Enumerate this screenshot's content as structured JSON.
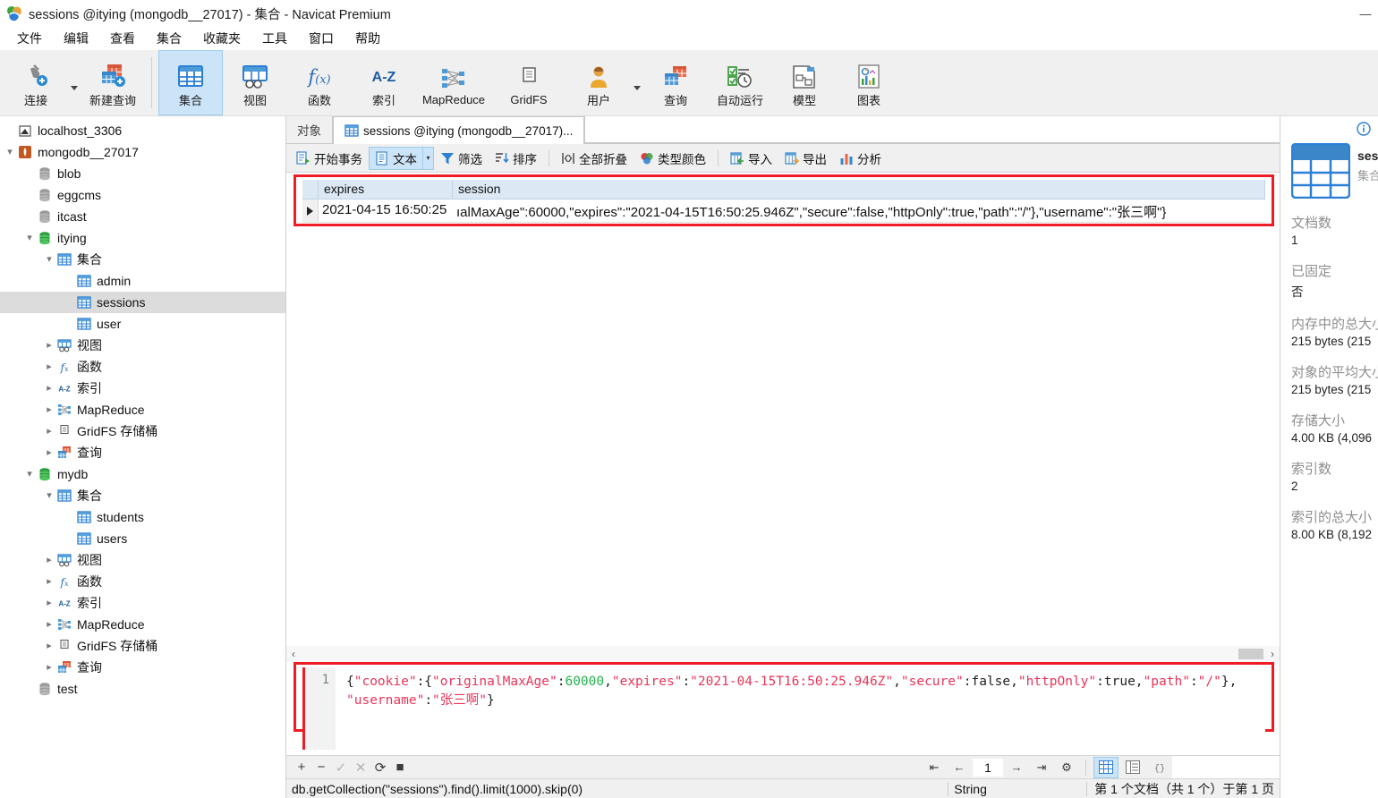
{
  "window": {
    "title": "sessions @itying (mongodb__27017) - 集合 - Navicat Premium",
    "minimize_label": "—",
    "logo_icon": "navicat-logo-icon"
  },
  "menubar": {
    "items": [
      {
        "label": "文件",
        "name": "menu-file"
      },
      {
        "label": "编辑",
        "name": "menu-edit"
      },
      {
        "label": "查看",
        "name": "menu-view"
      },
      {
        "label": "集合",
        "name": "menu-collection"
      },
      {
        "label": "收藏夹",
        "name": "menu-favorites"
      },
      {
        "label": "工具",
        "name": "menu-tools"
      },
      {
        "label": "窗口",
        "name": "menu-window"
      },
      {
        "label": "帮助",
        "name": "menu-help"
      }
    ]
  },
  "toolbar": {
    "items": [
      {
        "label": "连接",
        "icon": "connection-icon",
        "active": false,
        "caret": true
      },
      {
        "label": "新建查询",
        "icon": "new-query-icon",
        "active": false,
        "caret": false
      },
      {
        "label": "集合",
        "icon": "collection-icon",
        "active": true,
        "caret": false
      },
      {
        "label": "视图",
        "icon": "view-icon",
        "active": false,
        "caret": false
      },
      {
        "label": "函数",
        "icon": "function-icon",
        "active": false,
        "caret": false
      },
      {
        "label": "索引",
        "icon": "index-icon",
        "active": false,
        "caret": false
      },
      {
        "label": "MapReduce",
        "icon": "mapreduce-icon",
        "active": false,
        "caret": false
      },
      {
        "label": "GridFS",
        "icon": "gridfs-icon",
        "active": false,
        "caret": false
      },
      {
        "label": "用户",
        "icon": "user-icon",
        "active": false,
        "caret": true
      },
      {
        "label": "查询",
        "icon": "query-icon",
        "active": false,
        "caret": false
      },
      {
        "label": "自动运行",
        "icon": "automation-icon",
        "active": false,
        "caret": false
      },
      {
        "label": "模型",
        "icon": "model-icon",
        "active": false,
        "caret": false
      },
      {
        "label": "图表",
        "icon": "chart-icon",
        "active": false,
        "caret": false
      }
    ]
  },
  "sidebar": {
    "items": [
      {
        "label": "localhost_3306",
        "icon": "mysql-connection-icon",
        "indent": 0,
        "twisty": "",
        "selected": false
      },
      {
        "label": "mongodb__27017",
        "icon": "mongodb-connection-icon",
        "indent": 0,
        "twisty": "down",
        "selected": false
      },
      {
        "label": "blob",
        "icon": "database-icon",
        "indent": 1,
        "twisty": "",
        "selected": false
      },
      {
        "label": "eggcms",
        "icon": "database-icon",
        "indent": 1,
        "twisty": "",
        "selected": false
      },
      {
        "label": "itcast",
        "icon": "database-icon",
        "indent": 1,
        "twisty": "",
        "selected": false
      },
      {
        "label": "itying",
        "icon": "database-active-icon",
        "indent": 1,
        "twisty": "down",
        "selected": false
      },
      {
        "label": "集合",
        "icon": "collections-folder-icon",
        "indent": 2,
        "twisty": "down",
        "selected": false
      },
      {
        "label": "admin",
        "icon": "collection-item-icon",
        "indent": 3,
        "twisty": "",
        "selected": false
      },
      {
        "label": "sessions",
        "icon": "collection-item-icon",
        "indent": 3,
        "twisty": "",
        "selected": true
      },
      {
        "label": "user",
        "icon": "collection-item-icon",
        "indent": 3,
        "twisty": "",
        "selected": false
      },
      {
        "label": "视图",
        "icon": "views-folder-icon",
        "indent": 2,
        "twisty": "right",
        "selected": false
      },
      {
        "label": "函数",
        "icon": "functions-folder-icon",
        "indent": 2,
        "twisty": "right",
        "selected": false
      },
      {
        "label": "索引",
        "icon": "indexes-folder-icon",
        "indent": 2,
        "twisty": "right",
        "selected": false
      },
      {
        "label": "MapReduce",
        "icon": "mapreduce-folder-icon",
        "indent": 2,
        "twisty": "right",
        "selected": false
      },
      {
        "label": "GridFS 存储桶",
        "icon": "gridfs-folder-icon",
        "indent": 2,
        "twisty": "right",
        "selected": false
      },
      {
        "label": "查询",
        "icon": "queries-folder-icon",
        "indent": 2,
        "twisty": "right",
        "selected": false
      },
      {
        "label": "mydb",
        "icon": "database-active-icon",
        "indent": 1,
        "twisty": "down",
        "selected": false
      },
      {
        "label": "集合",
        "icon": "collections-folder-icon",
        "indent": 2,
        "twisty": "down",
        "selected": false
      },
      {
        "label": "students",
        "icon": "collection-item-icon",
        "indent": 3,
        "twisty": "",
        "selected": false
      },
      {
        "label": "users",
        "icon": "collection-item-icon",
        "indent": 3,
        "twisty": "",
        "selected": false
      },
      {
        "label": "视图",
        "icon": "views-folder-icon",
        "indent": 2,
        "twisty": "right",
        "selected": false
      },
      {
        "label": "函数",
        "icon": "functions-folder-icon",
        "indent": 2,
        "twisty": "right",
        "selected": false
      },
      {
        "label": "索引",
        "icon": "indexes-folder-icon",
        "indent": 2,
        "twisty": "right",
        "selected": false
      },
      {
        "label": "MapReduce",
        "icon": "mapreduce-folder-icon",
        "indent": 2,
        "twisty": "right",
        "selected": false
      },
      {
        "label": "GridFS 存储桶",
        "icon": "gridfs-folder-icon",
        "indent": 2,
        "twisty": "right",
        "selected": false
      },
      {
        "label": "查询",
        "icon": "queries-folder-icon",
        "indent": 2,
        "twisty": "right",
        "selected": false
      },
      {
        "label": "test",
        "icon": "database-icon",
        "indent": 1,
        "twisty": "",
        "selected": false
      }
    ]
  },
  "tabs": [
    {
      "label": "对象",
      "icon": "",
      "active": false
    },
    {
      "label": "sessions @itying (mongodb__27017)...",
      "icon": "collection-item-icon",
      "active": true
    }
  ],
  "subtoolbar": {
    "items": [
      {
        "label": "开始事务",
        "icon": "begin-transaction-icon",
        "toggled": false,
        "split": false
      },
      {
        "label": "文本",
        "icon": "text-view-icon",
        "toggled": true,
        "split": true
      },
      {
        "label": "筛选",
        "icon": "filter-icon",
        "toggled": false,
        "split": false
      },
      {
        "label": "排序",
        "icon": "sort-icon",
        "toggled": false,
        "split": false
      },
      {
        "label": "全部折叠",
        "icon": "collapse-all-icon",
        "toggled": false,
        "split": false
      },
      {
        "label": "类型颜色",
        "icon": "type-color-icon",
        "toggled": false,
        "split": false
      },
      {
        "label": "导入",
        "icon": "import-icon",
        "toggled": false,
        "split": false
      },
      {
        "label": "导出",
        "icon": "export-icon",
        "toggled": false,
        "split": false
      },
      {
        "label": "分析",
        "icon": "analyze-icon",
        "toggled": false,
        "split": false
      }
    ]
  },
  "grid": {
    "columns": [
      "expires",
      "session"
    ],
    "rows": [
      {
        "expires": "2021-04-15 16:50:25",
        "session": "ıalMaxAge\":60000,\"expires\":\"2021-04-15T16:50:25.946Z\",\"secure\":false,\"httpOnly\":true,\"path\":\"/\"},\"username\":\"张三啊\"}"
      }
    ]
  },
  "editor": {
    "line_number": "1",
    "tokens": [
      {
        "t": "{",
        "k": "punc"
      },
      {
        "t": "\"cookie\"",
        "k": "str"
      },
      {
        "t": ":{",
        "k": "punc"
      },
      {
        "t": "\"originalMaxAge\"",
        "k": "str"
      },
      {
        "t": ":",
        "k": "punc"
      },
      {
        "t": "60000",
        "k": "num"
      },
      {
        "t": ",",
        "k": "punc"
      },
      {
        "t": "\"expires\"",
        "k": "str"
      },
      {
        "t": ":",
        "k": "punc"
      },
      {
        "t": "\"2021-04-15T16:50:25.946Z\"",
        "k": "str"
      },
      {
        "t": ",",
        "k": "punc"
      },
      {
        "t": "\"secure\"",
        "k": "str"
      },
      {
        "t": ":false,",
        "k": "punc"
      },
      {
        "t": "\"httpOnly\"",
        "k": "str"
      },
      {
        "t": ":true,",
        "k": "punc"
      },
      {
        "t": "\"path\"",
        "k": "str"
      },
      {
        "t": ":",
        "k": "punc"
      },
      {
        "t": "\"/\"",
        "k": "str"
      },
      {
        "t": "},",
        "k": "punc"
      },
      {
        "t": "\n",
        "k": "punc"
      },
      {
        "t": "\"username\"",
        "k": "str"
      },
      {
        "t": ":",
        "k": "punc"
      },
      {
        "t": "\"张三啊\"",
        "k": "str"
      },
      {
        "t": "}",
        "k": "punc"
      }
    ]
  },
  "actionbar": {
    "buttons": [
      {
        "icon": "add-record-icon",
        "glyph": "+",
        "dim": false
      },
      {
        "icon": "remove-record-icon",
        "glyph": "−",
        "dim": false
      },
      {
        "icon": "apply-change-icon",
        "glyph": "✓",
        "dim": true
      },
      {
        "icon": "cancel-change-icon",
        "glyph": "✕",
        "dim": true
      },
      {
        "icon": "refresh-icon",
        "glyph": "⟳",
        "dim": false
      },
      {
        "icon": "stop-icon",
        "glyph": "■",
        "dim": false
      }
    ],
    "pager": {
      "first": "⇤",
      "prev": "←",
      "page_value": "1",
      "next": "→",
      "last": "⇥",
      "settings": "⚙"
    },
    "views": [
      {
        "icon": "grid-view-icon",
        "active": true
      },
      {
        "icon": "form-view-icon",
        "active": false
      },
      {
        "icon": "json-view-icon",
        "active": false
      }
    ]
  },
  "statusbar": {
    "sql": "db.getCollection(\"sessions\").find().limit(1000).skip(0)",
    "type": "String",
    "count": "第 1 个文档（共 1 个）于第 1 页"
  },
  "infopanel": {
    "info_icon": "info-icon",
    "thumb_icon": "collection-thumb-icon",
    "title": "sessions",
    "subtitle": "集合",
    "fields": [
      {
        "key": "文档数",
        "value": "1"
      },
      {
        "key": "已固定",
        "value": "否"
      },
      {
        "key": "内存中的总大小",
        "value": "215 bytes (215"
      },
      {
        "key": "对象的平均大小",
        "value": "215 bytes (215"
      },
      {
        "key": "存储大小",
        "value": "4.00 KB (4,096"
      },
      {
        "key": "索引数",
        "value": "2"
      },
      {
        "key": "索引的总大小",
        "value": "8.00 KB (8,192"
      }
    ]
  },
  "colors": {
    "accent": "#1a7fc1",
    "highlight_box": "#ee1c25",
    "selection": "#cce4f7",
    "header_blue": "#dce9f5",
    "json_string": "#e8355a",
    "json_number": "#22b14c"
  }
}
